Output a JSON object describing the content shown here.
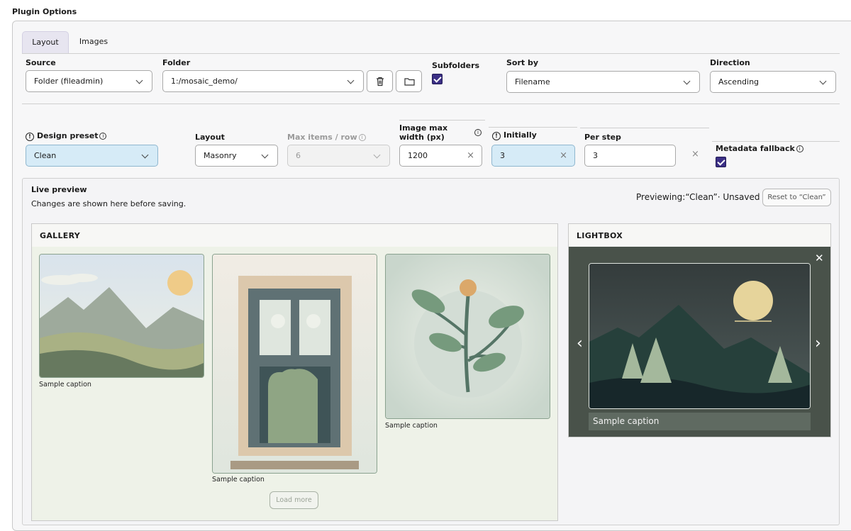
{
  "header": {
    "title": "Plugin Options"
  },
  "tabs": [
    {
      "label": "Layout"
    },
    {
      "label": "Images"
    }
  ],
  "row1": {
    "source": {
      "label": "Source",
      "value": "Folder (fileadmin)"
    },
    "folder": {
      "label": "Folder",
      "value": "1:/mosaic_demo/",
      "delete_icon": "trash-icon",
      "browse_icon": "folder-icon"
    },
    "subfolders": {
      "label": "Subfolders",
      "checked": true
    },
    "sort_by": {
      "label": "Sort by",
      "value": "Filename"
    },
    "direction": {
      "label": "Direction",
      "value": "Ascending"
    }
  },
  "row2": {
    "design_preset": {
      "label": "Design preset",
      "value": "Clean"
    },
    "layout": {
      "label": "Layout",
      "value": "Masonry"
    },
    "max_items": {
      "label": "Max items / row",
      "value": "6"
    },
    "image_max_width": {
      "label_line1": "Image max",
      "label_line2": "width (px)",
      "value": "1200"
    },
    "initially": {
      "label": "Initially",
      "value": "3"
    },
    "per_step": {
      "label": "Per step",
      "value": "3"
    },
    "metadata_fallback": {
      "label": "Metadata fallback",
      "checked": true
    }
  },
  "preview": {
    "title": "Live preview",
    "subtitle": "Changes are shown here before saving.",
    "status_prefix": "Previewing:",
    "status_preset": "“Clean”",
    "status_sep": "·",
    "status_state": "Unsaved",
    "reset_label": "Reset to “Clean”",
    "gallery": {
      "title": "GALLERY",
      "captions": [
        "Sample caption",
        "Sample caption",
        "Sample caption"
      ],
      "load_more": "Load more"
    },
    "lightbox": {
      "title": "LIGHTBOX",
      "caption": "Sample caption",
      "close": "✕",
      "prev": "‹",
      "next": "›"
    }
  },
  "colors": {
    "accent": "#3b2f85",
    "preset_highlight": "#d6ebf7",
    "lightbox_bg": "#49524a"
  }
}
